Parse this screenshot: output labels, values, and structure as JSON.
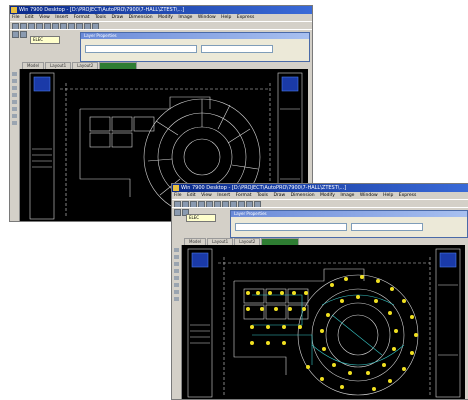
{
  "windows": {
    "back": {
      "title": "Win 7900 Desktop - [D:\\PROJECT\\AutoPRO\\7900\\7-HALL\\ZTEST\\...]",
      "menu": [
        "File",
        "Edit",
        "View",
        "Insert",
        "Format",
        "Tools",
        "Draw",
        "Dimension",
        "Modify",
        "Image",
        "Window",
        "Help",
        "Express"
      ],
      "dialog_title": "Layer Properties",
      "layer_label": "ELEC",
      "tabs": [
        "Model",
        "Layout1",
        "Layout2"
      ]
    },
    "front": {
      "title": "Win 7900 Desktop - [D:\\PROJECT\\AutoPRO\\7900\\7-HALL\\ZTEST\\...]",
      "menu": [
        "File",
        "Edit",
        "View",
        "Insert",
        "Format",
        "Tools",
        "Draw",
        "Dimension",
        "Modify",
        "Image",
        "Window",
        "Help",
        "Express"
      ],
      "dialog_title": "Layer Properties",
      "layer_label": "ELEC",
      "tabs": [
        "Model",
        "Layout1",
        "Layout2"
      ]
    }
  },
  "colors": {
    "canvas_bg": "#000000",
    "line_white": "#d8d8d8",
    "line_cyan": "#38c8c8",
    "symbol_yellow": "#f0e020",
    "title_bar": "#0a2a8a"
  }
}
